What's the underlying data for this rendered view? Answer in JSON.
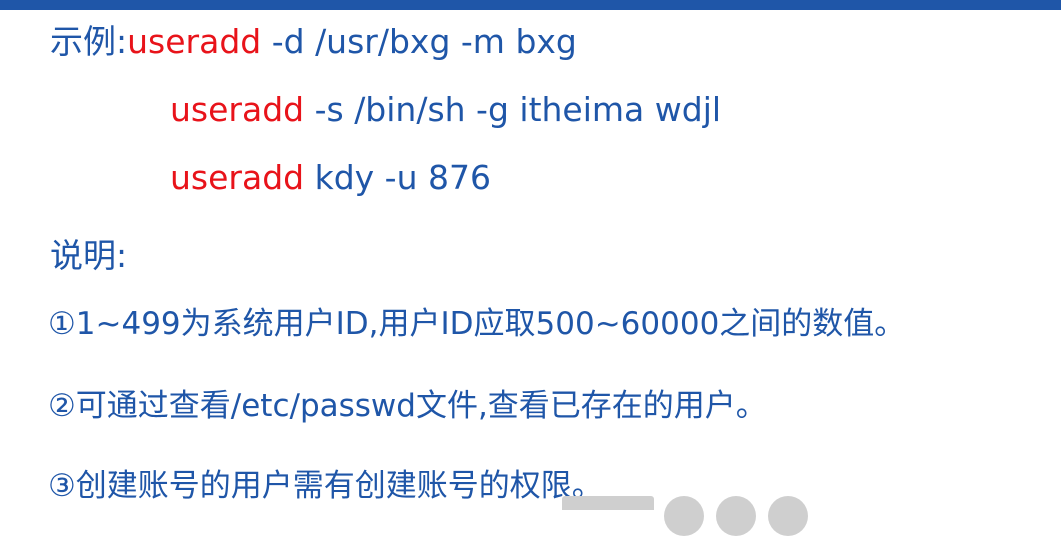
{
  "colors": {
    "text_blue": "#1f56a8",
    "command_red": "#e8131a",
    "top_bar": "#1f56a8"
  },
  "examples": {
    "label": "示例:",
    "lines": [
      {
        "cmd": "useradd",
        "args": " -d /usr/bxg -m bxg"
      },
      {
        "cmd": "useradd",
        "args": " -s /bin/sh -g itheima wdjl"
      },
      {
        "cmd": "useradd",
        "args": " kdy -u 876"
      }
    ]
  },
  "notes": {
    "label": "说明:",
    "items": [
      "①1~499为系统用户ID,用户ID应取500~60000之间的数值。",
      "②可通过查看/etc/passwd文件,查看已存在的用户。",
      "③创建账号的用户需有创建账号的权限。"
    ]
  }
}
